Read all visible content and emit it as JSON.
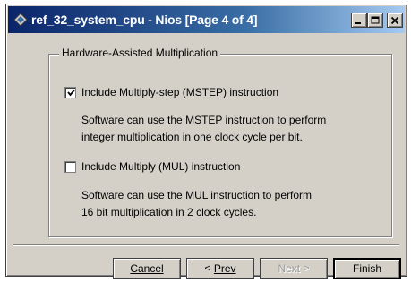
{
  "window": {
    "title": "ref_32_system_cpu - Nios [Page 4 of 4]",
    "icons": [
      "app-icon",
      "minimize-icon",
      "maximize-icon",
      "close-icon"
    ]
  },
  "group": {
    "legend": "Hardware-Assisted Multiplication",
    "mstep": {
      "label": "Include Multiply-step (MSTEP) instruction",
      "checked": true,
      "desc_line1": "Software can use the MSTEP instruction to perform",
      "desc_line2": "integer multiplication in one clock cycle per bit."
    },
    "mul": {
      "label": "Include Multiply (MUL) instruction",
      "checked": false,
      "desc_line1": "Software can use the MUL instruction to perform",
      "desc_line2": "16 bit multiplication in 2 clock cycles."
    }
  },
  "buttons": {
    "cancel": "Cancel",
    "prev": "Prev",
    "next": "Next",
    "finish": "Finish"
  },
  "colors": {
    "title_bar_start": "#0a246a",
    "title_bar_end": "#a6caf0",
    "face": "#d4d0c8"
  }
}
